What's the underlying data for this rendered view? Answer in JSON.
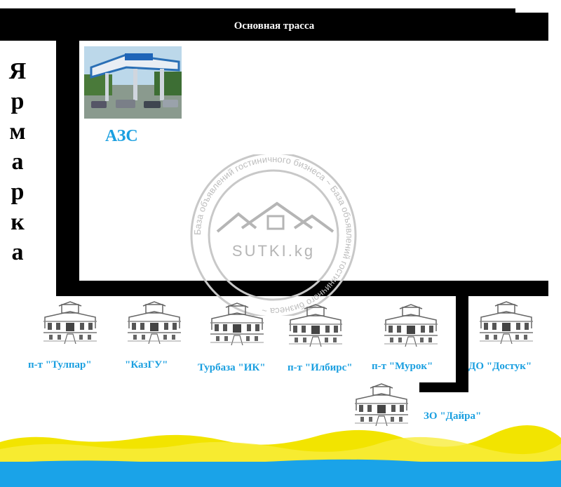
{
  "main_road": {
    "label": "Основная трасса"
  },
  "fair": {
    "label": "Ярмарка",
    "letters": [
      "Я",
      "р",
      "м",
      "а",
      "р",
      "к",
      "а"
    ]
  },
  "gas_station": {
    "label": "АЗС"
  },
  "watermark": {
    "text": "SUTKI.kg",
    "ring_text": "База объявлений гостиничного бизнеса ~ База объявлений гостиничного бизнеса ~"
  },
  "places": [
    {
      "label": "п-т \"Тулпар\""
    },
    {
      "label": "\"КазГУ\""
    },
    {
      "label": "Турбаза \"ИК\""
    },
    {
      "label": "п-т \"Илбирс\""
    },
    {
      "label": "п-т \"Мурок\""
    },
    {
      "label": "ДО \"Достук\""
    },
    {
      "label": "ЗО \"Дайра\""
    }
  ],
  "colors": {
    "road": "#000000",
    "label": "#1a9fe0",
    "sand": "#f2e400",
    "water": "#1aa3e8"
  }
}
